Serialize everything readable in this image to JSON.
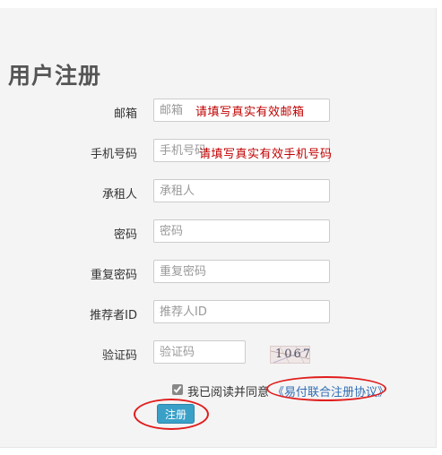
{
  "title": "用户注册",
  "fields": [
    {
      "label": "邮箱",
      "placeholder": "邮箱",
      "hint": "请填写真实有效邮箱"
    },
    {
      "label": "手机号码",
      "placeholder": "手机号码",
      "hint": "请填写真实有效手机号码"
    },
    {
      "label": "承租人",
      "placeholder": "承租人"
    },
    {
      "label": "密码",
      "placeholder": "密码"
    },
    {
      "label": "重复密码",
      "placeholder": "重复密码"
    },
    {
      "label": "推荐者ID",
      "placeholder": "推荐人ID"
    },
    {
      "label": "验证码",
      "placeholder": "验证码"
    }
  ],
  "captcha": {
    "text": "1067"
  },
  "agreement": {
    "checked": true,
    "text": "我已阅读并同意",
    "link": "《易付联合注册协议》"
  },
  "submit": {
    "label": "注册"
  },
  "annotation_color": "#e11d1d",
  "accent_color": "#3aa0c8"
}
